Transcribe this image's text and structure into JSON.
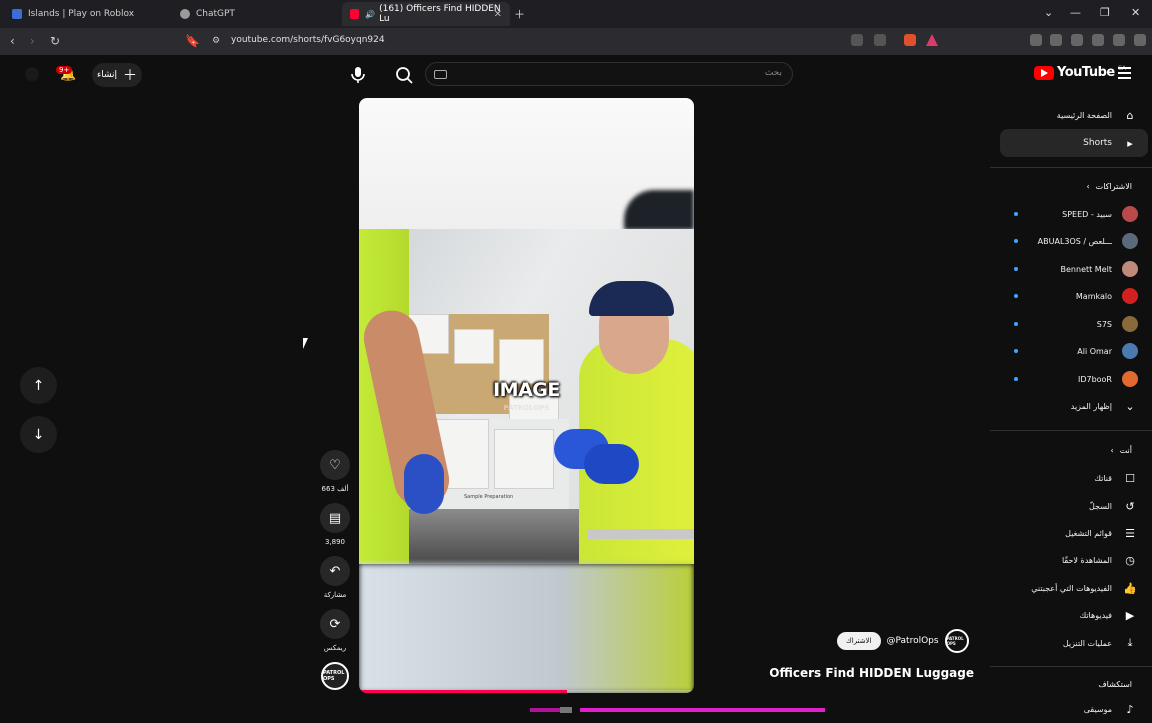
{
  "browser": {
    "tabs": [
      {
        "title": "Islands | Play on Roblox",
        "active": false
      },
      {
        "title": "ChatGPT",
        "active": false
      },
      {
        "title": "(161) Officers Find HIDDEN Lu",
        "active": true
      }
    ],
    "url": "youtube.com/shorts/fvG6oyqn924"
  },
  "header": {
    "notification_count": "9+",
    "create_label": "إنشاء",
    "search_placeholder": "بحث",
    "logo_text": "YouTube",
    "logo_region": "CA"
  },
  "video": {
    "caption": "IMAGE",
    "watermark": "PATROLOPS",
    "sample_label": "Sample Preparation",
    "progress_fraction": 0.62
  },
  "actions": {
    "likes": "663 ألف",
    "comments": "3,890",
    "share": "مشاركة",
    "remix": "ريمكس",
    "avatar_text": "PATROL OPS"
  },
  "meta": {
    "subscribe_label": "الاشتراك",
    "channel_handle": "@PatrolOps",
    "title": "Officers Find HIDDEN Luggage",
    "avatar_text": "PATROL OPS"
  },
  "sidebar": {
    "home": "الصفحة الرئيسية",
    "shorts": "Shorts",
    "subscriptions_header": "الاشتراكات",
    "subscriptions": [
      {
        "name": "SPEED - سبيد",
        "color": "#b94a4a"
      },
      {
        "name": "ABUAL3OS / ـــلعص",
        "color": "#5a6a7a"
      },
      {
        "name": "Bennett Melt",
        "color": "#c08a7a"
      },
      {
        "name": "Mamkalo",
        "color": "#d02020"
      },
      {
        "name": "S7S",
        "color": "#8a6a3a"
      },
      {
        "name": "Ali Omar",
        "color": "#4a7ab0"
      },
      {
        "name": "ID7booR",
        "color": "#e06a30"
      }
    ],
    "show_more": "إظهار المزيد",
    "you_header": "أنت",
    "you_items": [
      {
        "label": "قناتك",
        "icon": "channel-icon"
      },
      {
        "label": "السجلّ",
        "icon": "history-icon"
      },
      {
        "label": "قوائم التشغيل",
        "icon": "playlists-icon"
      },
      {
        "label": "المشاهدة لاحقًا",
        "icon": "watch-later-icon"
      },
      {
        "label": "الفيديوهات التي أعجبتني",
        "icon": "like-icon"
      },
      {
        "label": "فيديوهاتك",
        "icon": "your-videos-icon"
      },
      {
        "label": "عمليات التنزيل",
        "icon": "download-icon"
      }
    ],
    "explore_header": "استكشاف",
    "explore_items": [
      {
        "label": "موسيقى",
        "icon": "music-icon"
      }
    ]
  }
}
